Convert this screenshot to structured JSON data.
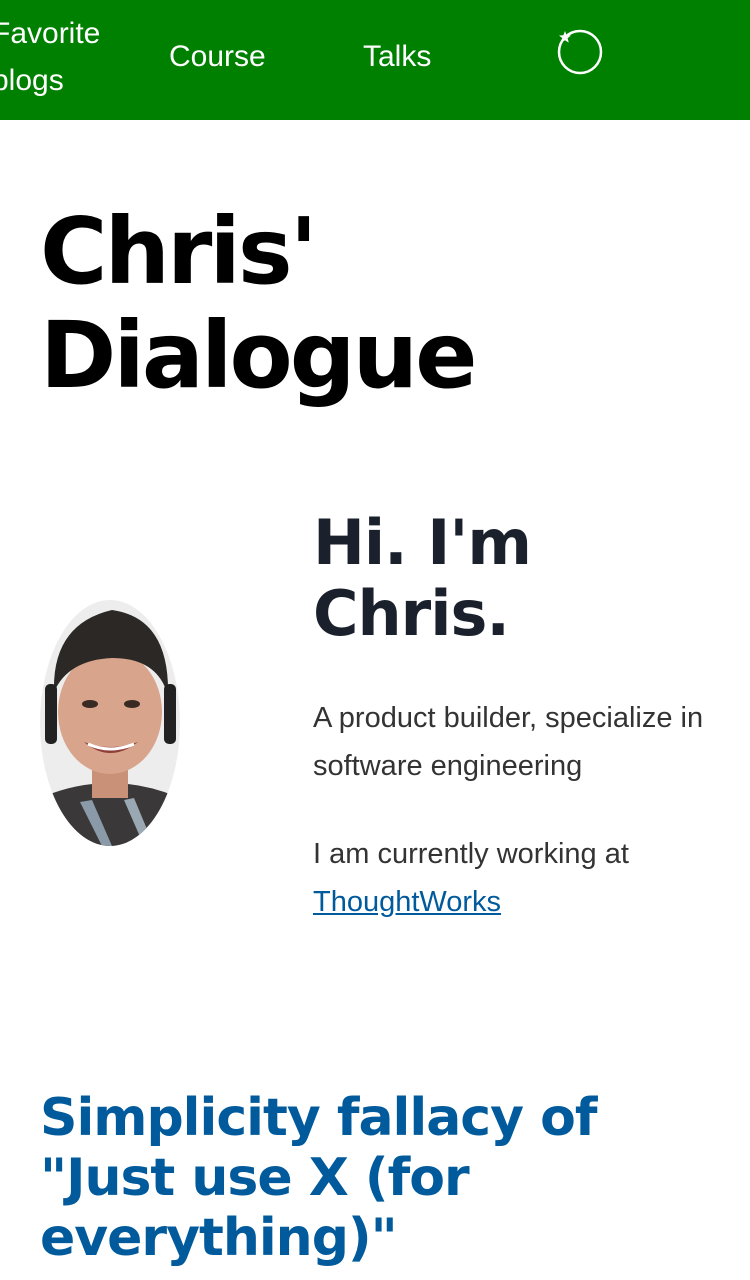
{
  "nav": {
    "favorite_blogs": "Favorite blogs",
    "course": "Course",
    "talks": "Talks",
    "theme_toggle_icon": "theme-toggle-icon"
  },
  "site": {
    "title_line1": "Chris'",
    "title_line2": "Dialogue"
  },
  "intro": {
    "greeting_line1": "Hi. I'm",
    "greeting_line2": "Chris.",
    "bio": "A product builder, specialize in software engineering",
    "work_prefix": "I am currently working at",
    "work_company": "ThoughtWorks"
  },
  "post": {
    "title": "Simplicity fallacy of \"Just use X (for everything)\""
  },
  "colors": {
    "nav_bg": "#008000",
    "link": "#005a9c",
    "heading": "#1a202c"
  }
}
